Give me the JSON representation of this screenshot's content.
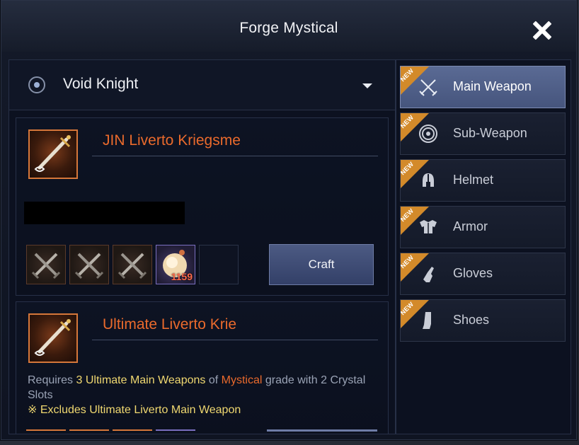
{
  "dialog": {
    "title": "Forge Mystical"
  },
  "class_selector": {
    "value": "Void Knight"
  },
  "cards": [
    {
      "item_name": "JIN Liverto Kriegsme",
      "materials": [
        {
          "type": "weapon"
        },
        {
          "type": "weapon"
        },
        {
          "type": "weapon"
        },
        {
          "type": "crystal",
          "count": "1159"
        },
        {
          "type": "empty"
        }
      ],
      "craft_label": "Craft"
    },
    {
      "item_name": "Ultimate Liverto Krie",
      "requirement": {
        "prefix": "Requires ",
        "count_item": "3 Ultimate Main Weapons",
        "mid": " of ",
        "grade": "Mystical",
        "suffix": " grade with 2 Crystal Slots",
        "note": "※ Excludes Ultimate Liverto Main Weapon"
      }
    }
  ],
  "categories": [
    {
      "label": "Main Weapon",
      "icon": "crossed-swords-icon",
      "badge": "NEW",
      "active": true
    },
    {
      "label": "Sub-Weapon",
      "icon": "shield-icon",
      "badge": "NEW",
      "active": false
    },
    {
      "label": "Helmet",
      "icon": "helmet-icon",
      "badge": "NEW",
      "active": false
    },
    {
      "label": "Armor",
      "icon": "armor-icon",
      "badge": "NEW",
      "active": false
    },
    {
      "label": "Gloves",
      "icon": "gloves-icon",
      "badge": "NEW",
      "active": false
    },
    {
      "label": "Shoes",
      "icon": "shoes-icon",
      "badge": "NEW",
      "active": false
    }
  ],
  "colors": {
    "accent_orange": "#ea6a2c",
    "highlight_yellow": "#f0d870",
    "badge": "#d38a2a",
    "active_tab": "#5a6a94"
  }
}
